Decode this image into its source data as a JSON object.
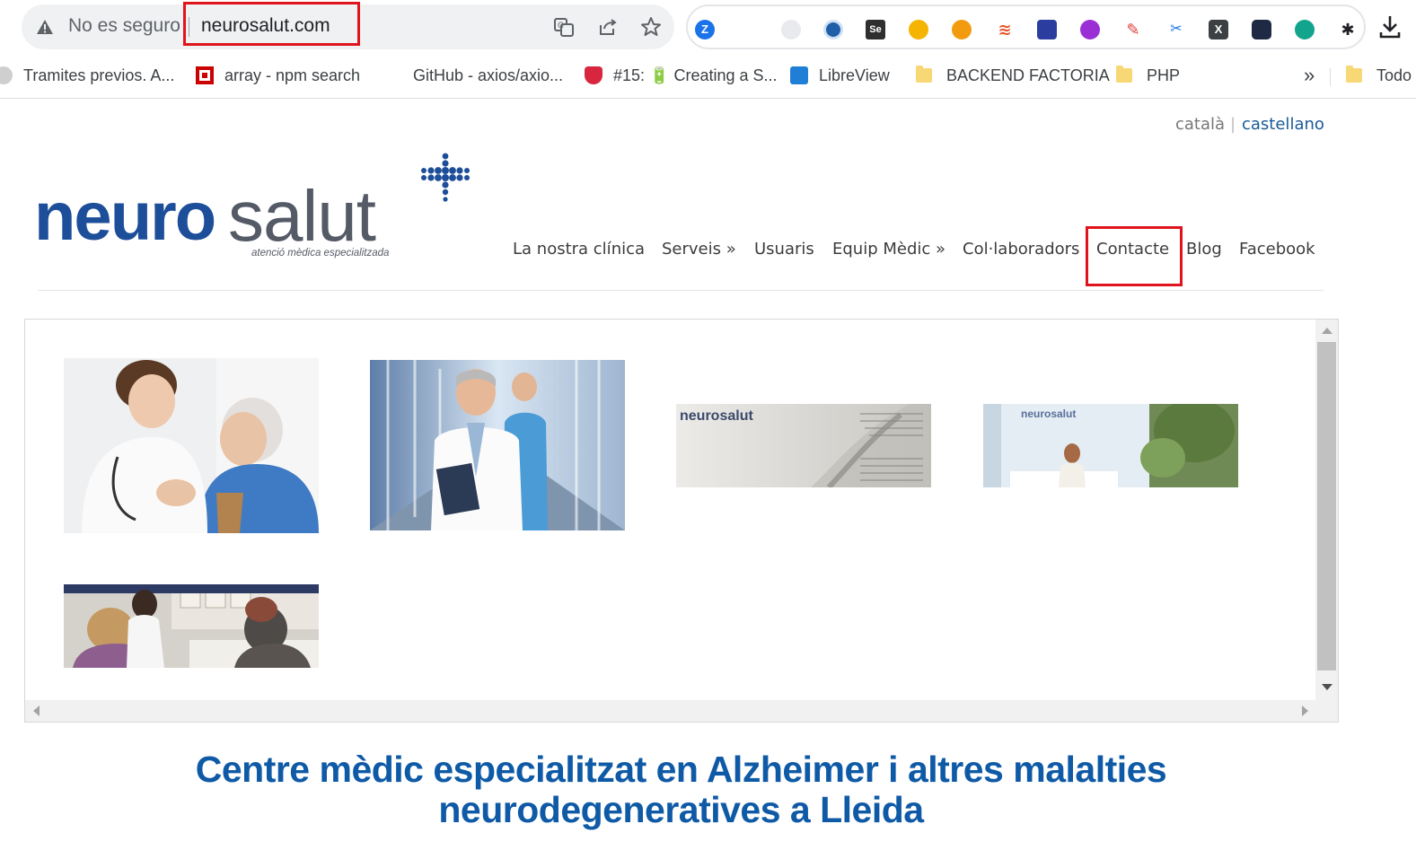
{
  "browser": {
    "security_label": "No es seguro",
    "url": "neurosalut.com"
  },
  "bookmarks": {
    "items": [
      {
        "label": "Tramites previos. A..."
      },
      {
        "label": "array - npm search"
      },
      {
        "label": "GitHub - axios/axio..."
      },
      {
        "label": "#15: 🔋 Creating a S..."
      },
      {
        "label": "LibreView"
      },
      {
        "label": "BACKEND FACTORIA"
      },
      {
        "label": "PHP"
      }
    ],
    "overflow": "»",
    "other": "Todo"
  },
  "site": {
    "languages": {
      "catalan": "català",
      "separator": "|",
      "spanish": "castellano"
    },
    "logo": {
      "part1": "neuro",
      "part2": "salut",
      "tagline": "atenció mèdica especialitzada"
    },
    "nav": [
      {
        "label": "La nostra clínica"
      },
      {
        "label": "Serveis »"
      },
      {
        "label": "Usuaris"
      },
      {
        "label": "Equip Mèdic »"
      },
      {
        "label": "Col·laboradors"
      },
      {
        "label": "Contacte"
      },
      {
        "label": "Blog"
      },
      {
        "label": "Facebook"
      }
    ],
    "gallery": {
      "thumb3_text": "neurosalut",
      "thumb4_text": "neurosalut"
    },
    "headline": "Centre mèdic especialitzat en Alzheimer i altres malalties neurodegeneratives a Lleida"
  },
  "colors": {
    "highlight": "#e0141c",
    "brand_blue": "#1d4e99",
    "headline_blue": "#0f5aa6",
    "link_blue": "#1a5a98"
  }
}
